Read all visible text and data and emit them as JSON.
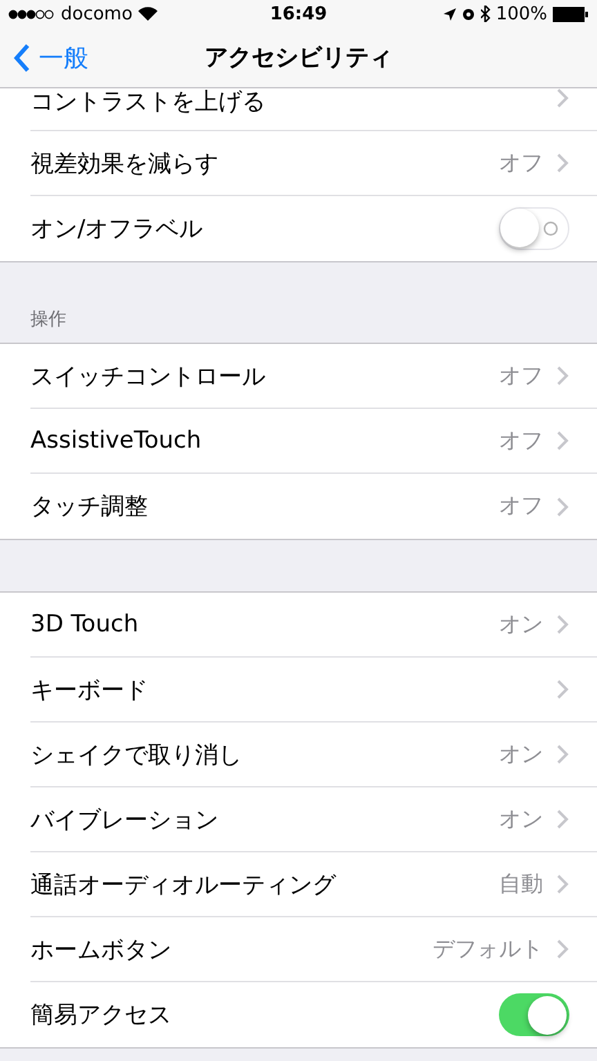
{
  "status_bar": {
    "carrier": "docomo",
    "time": "16:49",
    "battery": "100%"
  },
  "nav": {
    "back": "一般",
    "title": "アクセシビリティ"
  },
  "sections": [
    {
      "rows": [
        {
          "label": "コントラストを上げる",
          "kind": "chevron",
          "clipped": true
        },
        {
          "label": "視差効果を減らす",
          "value": "オフ",
          "kind": "chevron"
        },
        {
          "label": "オン/オフラベル",
          "kind": "switch",
          "on": false
        }
      ]
    },
    {
      "header": "操作",
      "rows": [
        {
          "label": "スイッチコントロール",
          "value": "オフ",
          "kind": "chevron"
        },
        {
          "label": "AssistiveTouch",
          "value": "オフ",
          "kind": "chevron"
        },
        {
          "label": "タッチ調整",
          "value": "オフ",
          "kind": "chevron"
        }
      ]
    },
    {
      "rows": [
        {
          "label": "3D Touch",
          "value": "オン",
          "kind": "chevron"
        },
        {
          "label": "キーボード",
          "kind": "chevron"
        },
        {
          "label": "シェイクで取り消し",
          "value": "オン",
          "kind": "chevron"
        },
        {
          "label": "バイブレーション",
          "value": "オン",
          "kind": "chevron"
        },
        {
          "label": "通話オーディオルーティング",
          "value": "自動",
          "kind": "chevron"
        },
        {
          "label": "ホームボタン",
          "value": "デフォルト",
          "kind": "chevron"
        },
        {
          "label": "簡易アクセス",
          "kind": "switch",
          "on": true
        }
      ]
    }
  ]
}
